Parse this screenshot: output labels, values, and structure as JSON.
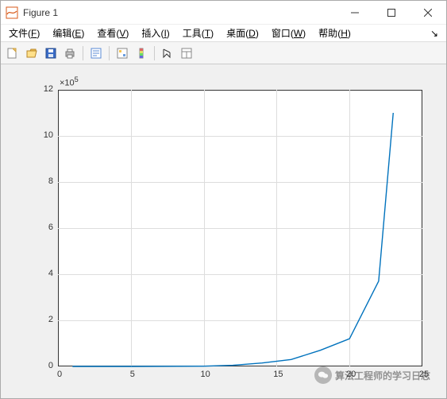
{
  "window": {
    "title": "Figure 1"
  },
  "menubar": {
    "file": "文件",
    "file_mn": "F",
    "edit": "编辑",
    "edit_mn": "E",
    "view": "查看",
    "view_mn": "V",
    "insert": "插入",
    "insert_mn": "I",
    "tools": "工具",
    "tools_mn": "T",
    "desktop": "桌面",
    "desktop_mn": "D",
    "windowm": "窗口",
    "windowm_mn": "W",
    "help": "帮助",
    "help_mn": "H"
  },
  "chart_data": {
    "type": "line",
    "x": [
      1,
      5,
      10,
      12,
      14,
      16,
      18,
      20,
      22,
      23
    ],
    "y": [
      0,
      0,
      1000,
      5000,
      15000,
      30000,
      70000,
      120000,
      370000,
      1100000
    ],
    "exponent_label": "×10",
    "exponent_sup": "5",
    "xlabel": "",
    "ylabel": "",
    "xlim": [
      0,
      25
    ],
    "ylim": [
      0,
      1200000
    ],
    "xticks": [
      0,
      5,
      10,
      15,
      20,
      25
    ],
    "yticks_scaled": [
      0,
      2,
      4,
      6,
      8,
      10,
      12
    ],
    "grid": true,
    "line_color": "#0072bd"
  },
  "watermark": {
    "text": "算法工程师的学习日志"
  }
}
